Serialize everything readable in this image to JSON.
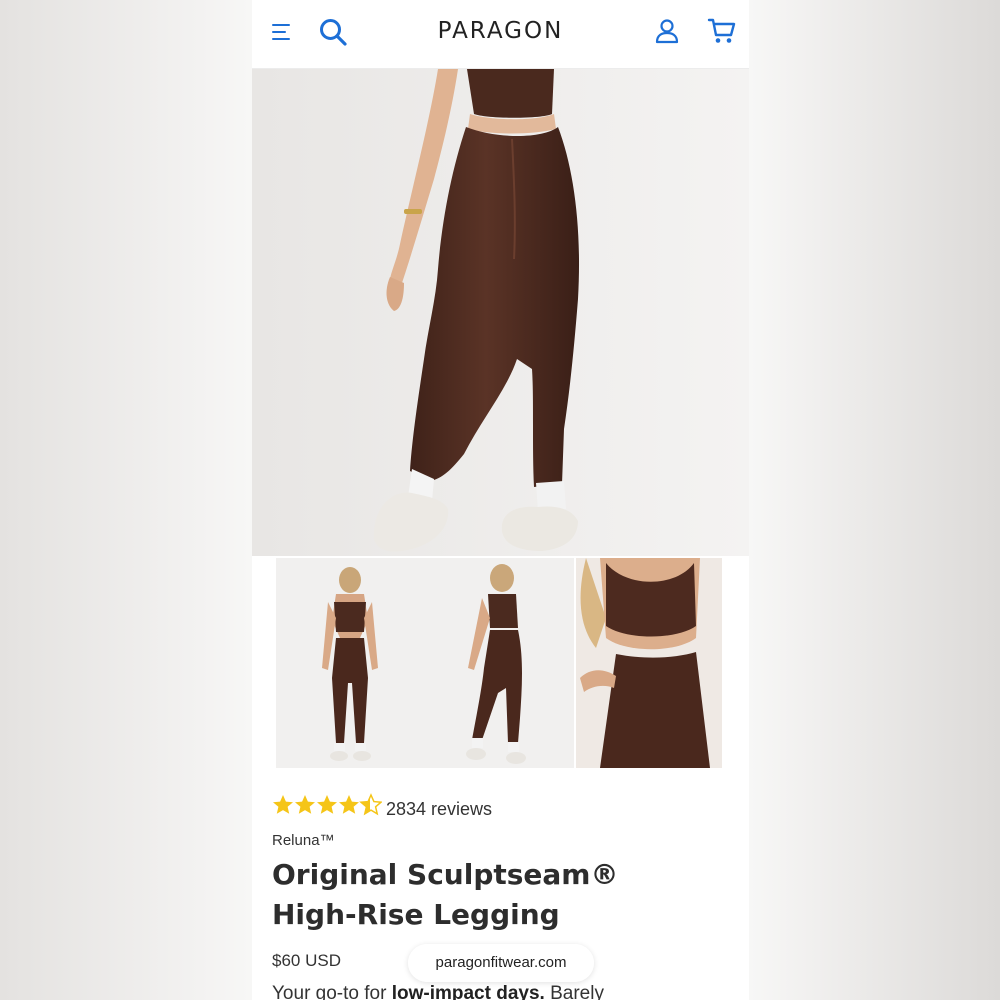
{
  "header": {
    "brand": "PARAGON",
    "icons": [
      "menu-icon",
      "search-icon",
      "account-icon",
      "cart-icon"
    ],
    "accent_color": "#1d6fd6"
  },
  "gallery": {
    "main_image": "brown high-rise legging, back view, model in white sneakers",
    "thumbnails": [
      "back view full body",
      "three-quarter back view",
      "front waistband close-up"
    ],
    "selected_thumbnail_index": 1
  },
  "product": {
    "rating_value": 4.5,
    "rating_max": 5,
    "reviews_text": "2834 reviews",
    "vendor": "Reluna™",
    "title_line1": "Original Sculptseam®",
    "title_line2": "High-Rise Legging",
    "price": "$60 USD",
    "desc_prefix": "Your go-to for ",
    "desc_bold": "low-impact days.",
    "desc_suffix": " Barely",
    "star_color": "#f5c518"
  },
  "browser": {
    "url": "paragonfitwear.com"
  }
}
